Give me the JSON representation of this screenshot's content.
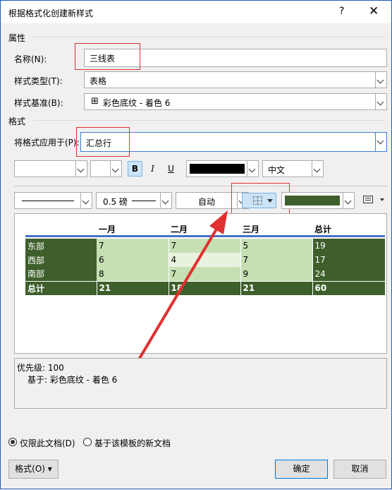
{
  "window": {
    "title": "根据格式化创建新样式",
    "help": "?",
    "close": "✕"
  },
  "properties": {
    "group": "属性",
    "name_label": "名称(N):",
    "name_value": "三线表",
    "type_label": "样式类型(T):",
    "type_value": "表格",
    "base_label": "样式基准(B):",
    "base_value": "彩色底纹 - 着色 6",
    "base_icon": "table-icon"
  },
  "format": {
    "group": "格式",
    "apply_label": "将格式应用于(P):",
    "apply_value": "汇总行",
    "font_value": "",
    "size_value": "",
    "bold": "B",
    "italic": "I",
    "underline": "U",
    "font_color": "#000000",
    "language": "中文",
    "line_weight": "0.5 磅",
    "line_color": "自动",
    "shading_color": "#3e5f2b"
  },
  "preview": {
    "headers": [
      "",
      "一月",
      "二月",
      "三月",
      "总计"
    ],
    "rows": [
      [
        "东部",
        "7",
        "7",
        "5",
        "19"
      ],
      [
        "西部",
        "6",
        "4",
        "7",
        "17"
      ],
      [
        "南部",
        "8",
        "7",
        "9",
        "24"
      ]
    ],
    "total": [
      "总计",
      "21",
      "18",
      "21",
      "60"
    ]
  },
  "info": {
    "priority": "优先级: 100",
    "based_on": "基于: 彩色底纹 - 着色 6"
  },
  "scope": {
    "this_doc": "仅限此文档(D)",
    "template": "基于该模板的新文档"
  },
  "buttons": {
    "format": "格式(O)",
    "ok": "确定",
    "cancel": "取消"
  },
  "colors": {
    "accent_red": "#e03030",
    "table_dark": "#3e5f2b",
    "table_light": "#c6e0b4"
  }
}
